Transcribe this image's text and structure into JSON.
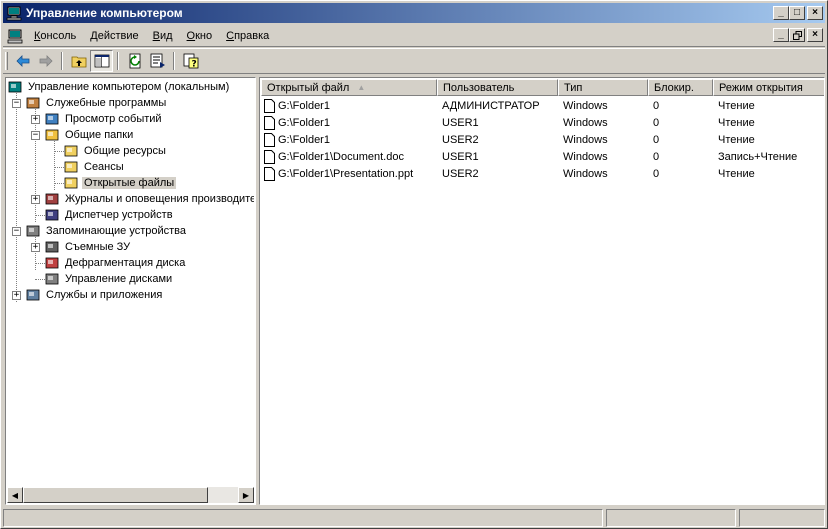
{
  "window": {
    "title": "Управление компьютером",
    "buttons": {
      "minimize": "_",
      "maximize": "□",
      "close": "×"
    }
  },
  "menu": [
    {
      "label": "Консоль",
      "accel": "К",
      "rest": "онсоль"
    },
    {
      "label": "Действие",
      "accel": "Д",
      "rest": "ействие"
    },
    {
      "label": "Вид",
      "accel": "В",
      "rest": "ид"
    },
    {
      "label": "Окно",
      "accel": "О",
      "rest": "кно"
    },
    {
      "label": "Справка",
      "accel": "С",
      "rest": "правка"
    }
  ],
  "toolbar": {
    "icons": [
      "back-arrow-icon",
      "forward-arrow-icon",
      "up-folder-icon",
      "show-hide-tree-icon",
      "refresh-icon",
      "export-list-icon",
      "help-icon"
    ]
  },
  "tree": {
    "items": [
      {
        "label": "Управление компьютером (локальным)",
        "icon": "computer-management-icon",
        "expander": ""
      },
      {
        "label": "Служебные программы",
        "icon": "system-tools-icon",
        "expander": "−"
      },
      {
        "label": "Просмотр событий",
        "icon": "event-viewer-icon",
        "expander": "+"
      },
      {
        "label": "Общие папки",
        "icon": "shared-folders-icon",
        "expander": "−"
      },
      {
        "label": "Общие ресурсы",
        "icon": "folder-icon",
        "expander": ""
      },
      {
        "label": "Сеансы",
        "icon": "folder-icon",
        "expander": ""
      },
      {
        "label": "Открытые файлы",
        "icon": "open-folder-icon",
        "expander": ""
      },
      {
        "label": "Журналы и оповещения производите",
        "icon": "performance-logs-icon",
        "expander": "+"
      },
      {
        "label": "Диспетчер устройств",
        "icon": "device-manager-icon",
        "expander": ""
      },
      {
        "label": "Запоминающие устройства",
        "icon": "storage-icon",
        "expander": "−"
      },
      {
        "label": "Съемные ЗУ",
        "icon": "removable-storage-icon",
        "expander": "+"
      },
      {
        "label": "Дефрагментация диска",
        "icon": "defrag-icon",
        "expander": ""
      },
      {
        "label": "Управление дисками",
        "icon": "disk-management-icon",
        "expander": ""
      },
      {
        "label": "Службы и приложения",
        "icon": "services-apps-icon",
        "expander": "+"
      }
    ],
    "selected": "Открытые файлы"
  },
  "list": {
    "columns": [
      "Открытый файл",
      "Пользователь",
      "Тип",
      "Блокир.",
      "Режим открытия"
    ],
    "sort_indicator": "▲",
    "rows": [
      [
        "G:\\Folder1",
        "АДМИНИСТРАТОР",
        "Windows",
        "0",
        "Чтение"
      ],
      [
        "G:\\Folder1",
        "USER1",
        "Windows",
        "0",
        "Чтение"
      ],
      [
        "G:\\Folder1",
        "USER2",
        "Windows",
        "0",
        "Чтение"
      ],
      [
        "G:\\Folder1\\Document.doc",
        "USER1",
        "Windows",
        "0",
        "Запись+Чтение"
      ],
      [
        "G:\\Folder1\\Presentation.ppt",
        "USER2",
        "Windows",
        "0",
        "Чтение"
      ]
    ]
  },
  "scrollbar": {
    "left_arrow": "◀",
    "right_arrow": "▶"
  }
}
